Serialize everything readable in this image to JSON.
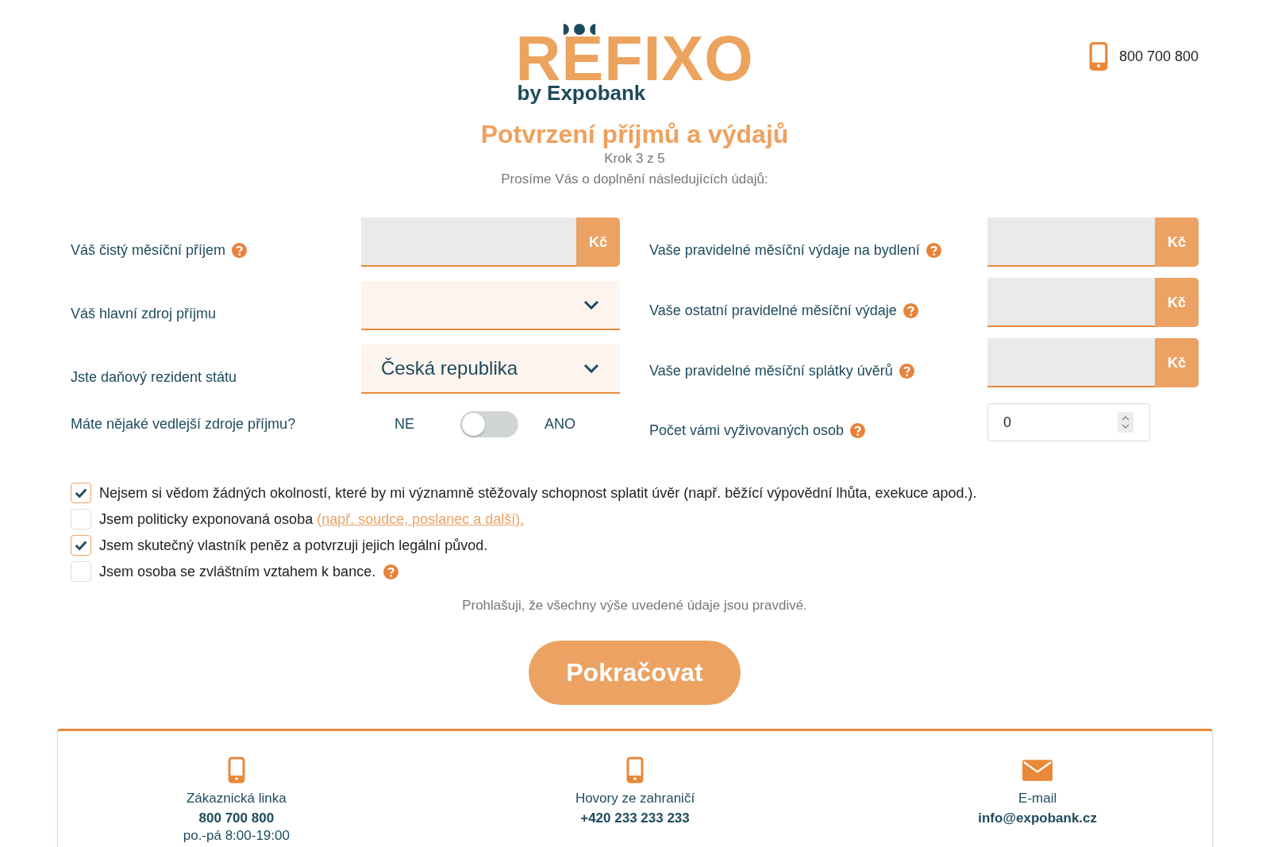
{
  "header": {
    "logo": {
      "wordmark": "REFIXO",
      "tagline": "by Expobank"
    },
    "phone": "800 700 800"
  },
  "title": "Potvrzení příjmů a výdajů",
  "step": "Krok 3 z 5",
  "intro": "Prosíme Vás o doplnění následujících údajů:",
  "left_fields": [
    {
      "kind": "currency",
      "label": "Váš čistý měsíční příjem",
      "help": true,
      "unit": "Kč"
    },
    {
      "kind": "select",
      "label": "Váš hlavní zdroj příjmu",
      "help": false
    },
    {
      "kind": "select",
      "label": "Jste daňový rezident státu",
      "help": false,
      "value": "Česká republika"
    },
    {
      "kind": "toggle",
      "label": "Máte nějaké vedlejší zdroje příjmu?",
      "help": false,
      "off_label": "NE",
      "on_label": "ANO",
      "on": false
    }
  ],
  "right_fields": [
    {
      "kind": "currency",
      "label": "Vaše pravidelné měsíční výdaje na bydlení",
      "help": true,
      "unit": "Kč"
    },
    {
      "kind": "currency",
      "label": "Vaše ostatní pravidelné měsíční výdaje",
      "help": true,
      "unit": "Kč"
    },
    {
      "kind": "currency",
      "label": "Vaše pravidelné měsíční splátky úvěrů",
      "help": true,
      "unit": "Kč"
    },
    {
      "kind": "number",
      "label": "Počet vámi vyživovaných osob",
      "help": true,
      "value": "0"
    }
  ],
  "checkboxes": [
    {
      "text": "Nejsem si vědom žádných okolností, které by mi významně stěžovaly schopnost splatit úvěr (např. běžící výpovědní lhůta, exekuce apod.).",
      "checked": true,
      "help": false
    },
    {
      "text": "Jsem politicky exponovaná osoba",
      "link": "(např. soudce, poslanec a další).",
      "checked": false,
      "help": false
    },
    {
      "text": "Jsem skutečný vlastník peněz a potvrzuji jejich legální původ.",
      "checked": true,
      "help": false
    },
    {
      "text": "Jsem osoba se zvláštním vztahem k bance.",
      "checked": false,
      "help": true
    }
  ],
  "declaration": "Prohlašuji, že všechny výše uvedené údaje jsou pravdivé.",
  "continue_button": "Pokračovat",
  "footer": [
    {
      "kind": "phone",
      "title": "Zákaznická linka",
      "value": "800 700 800",
      "note": "po.-pá 8:00-19:00"
    },
    {
      "kind": "phone",
      "title": "Hovory ze zahraničí",
      "value": "+420 233 233 233"
    },
    {
      "kind": "email",
      "title": "E-mail",
      "value": "info@expobank.cz"
    }
  ]
}
